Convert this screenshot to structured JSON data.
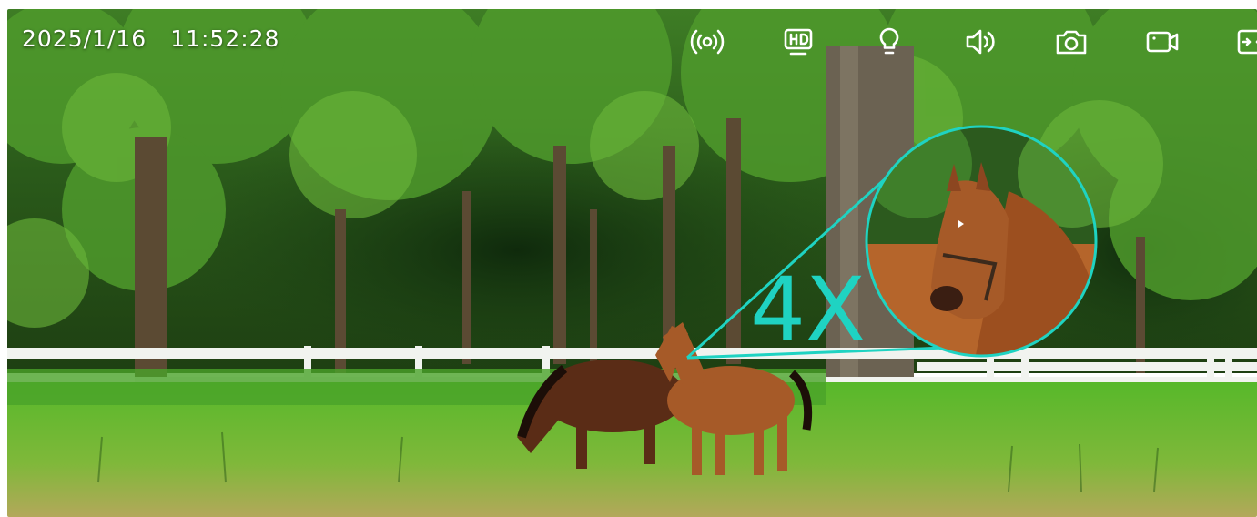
{
  "overlay": {
    "date": "2025/1/16",
    "time": "11:52:28",
    "zoom_label": "4X"
  },
  "toolbar": {
    "buttons": [
      {
        "name": "broadcast-icon"
      },
      {
        "name": "hd-quality-icon"
      },
      {
        "name": "light-bulb-icon"
      },
      {
        "name": "speaker-volume-icon"
      },
      {
        "name": "camera-snapshot-icon"
      },
      {
        "name": "video-record-icon"
      },
      {
        "name": "fit-screen-icon"
      }
    ]
  },
  "colors": {
    "accent": "#1fd3c2",
    "icon": "#ffffff"
  }
}
